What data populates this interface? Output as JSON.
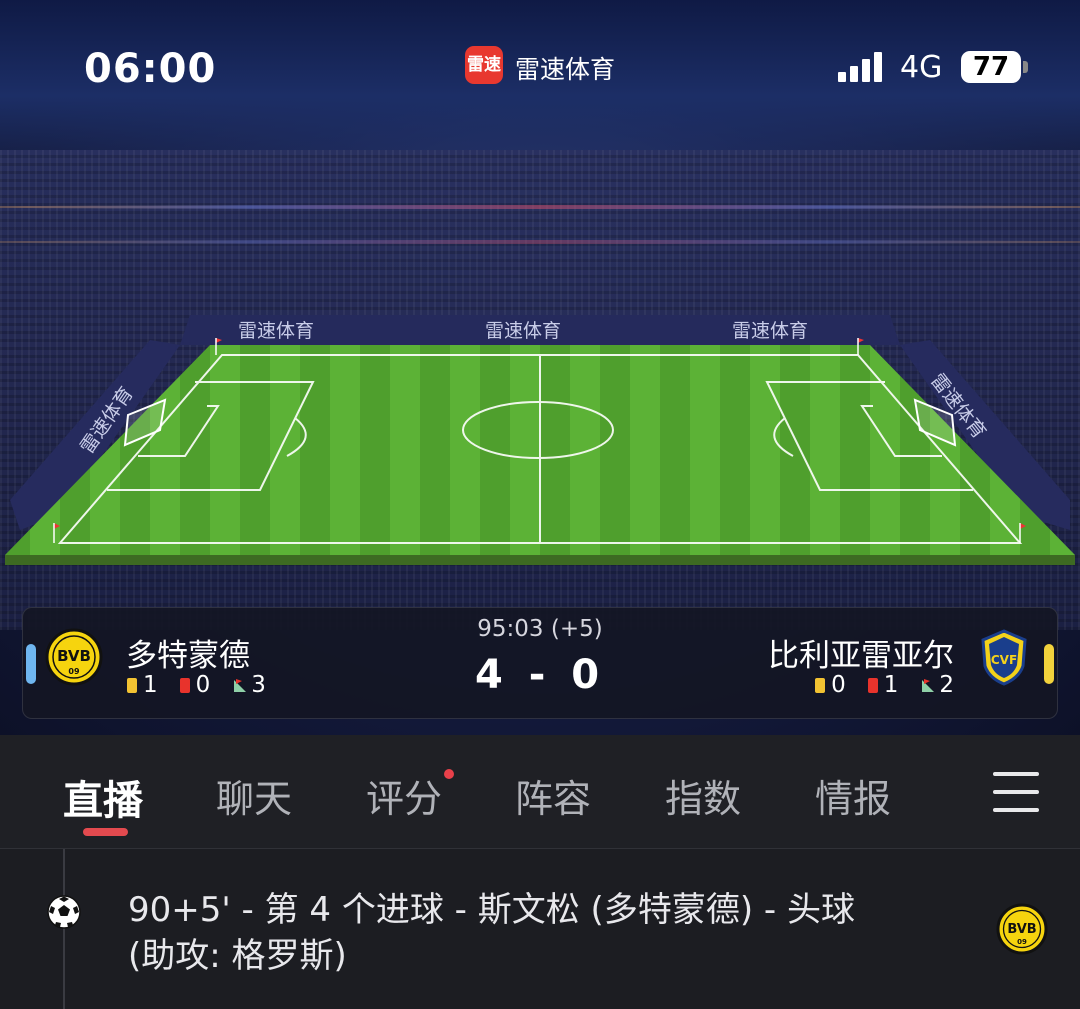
{
  "status_bar": {
    "time": "06:00",
    "app_logo_text": "雷速",
    "app_name": "雷速体育",
    "network": "4G",
    "battery": "77"
  },
  "pitch": {
    "ad_boards": [
      "雷速体育",
      "雷速体育",
      "雷速体育",
      "雷速体育",
      "雷速体育"
    ]
  },
  "match": {
    "minute": "95:03 (+5)",
    "score": "4 - 0",
    "home": {
      "name": "多特蒙德",
      "logo_text": "BVB",
      "logo_sub": "09",
      "indicator_color": "#6fb6f0",
      "yellow_cards": "1",
      "red_cards": "0",
      "corners": "3"
    },
    "away": {
      "name": "比利亚雷亚尔",
      "logo_text": "CVF",
      "indicator_color": "#f2d23c",
      "yellow_cards": "0",
      "red_cards": "1",
      "corners": "2"
    }
  },
  "tabs": [
    {
      "label": "直播",
      "active": true
    },
    {
      "label": "聊天"
    },
    {
      "label": "评分",
      "has_dot": true
    },
    {
      "label": "阵容"
    },
    {
      "label": "指数"
    },
    {
      "label": "情报"
    }
  ],
  "feed": {
    "events": [
      {
        "icon": "soccer-ball-icon",
        "text_line1": "90+5' - 第 4 个进球 - 斯文松 (多特蒙德) - 头球",
        "text_line2": "(助攻: 格罗斯)",
        "team_logo_text": "BVB",
        "team_logo_sub": "09"
      }
    ]
  },
  "colors": {
    "yellow_card": "#f2c232",
    "red_card": "#e8332c",
    "accent_red": "#e34a4f",
    "pitch_green": "#4e9a2c"
  }
}
